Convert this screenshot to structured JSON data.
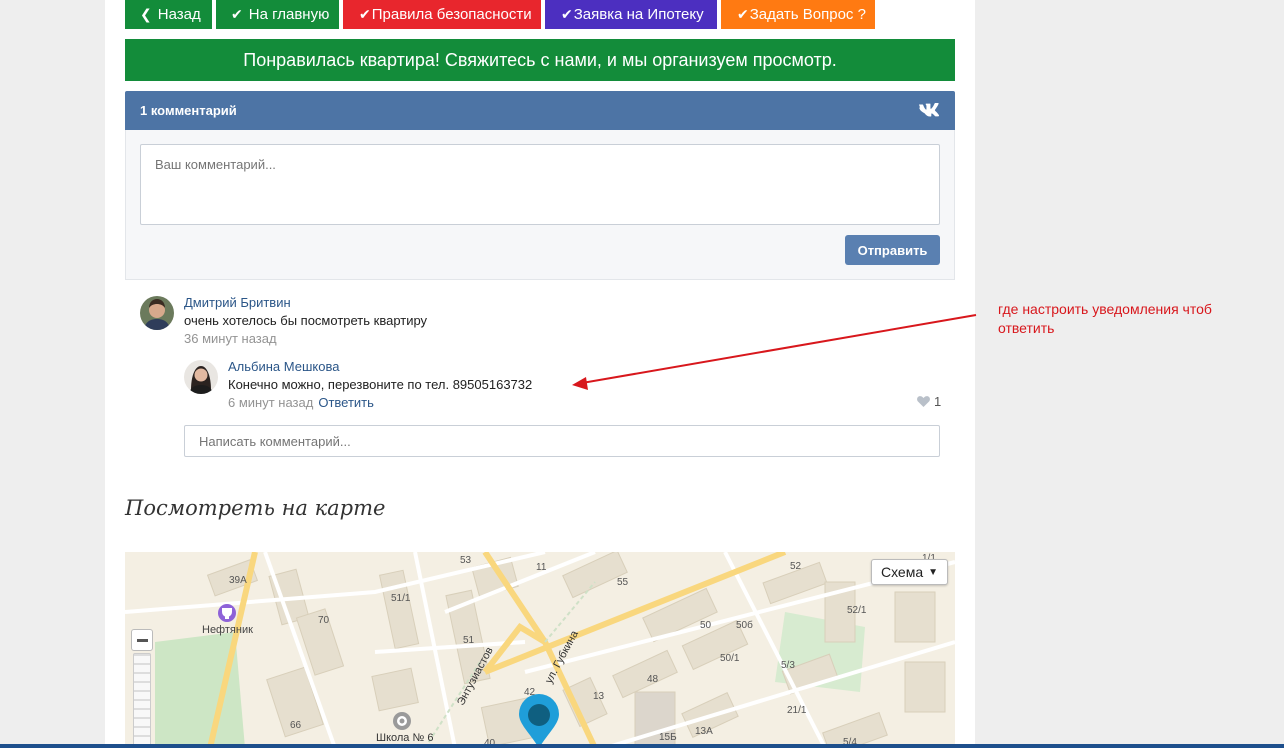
{
  "nav": {
    "back_label": "Назад",
    "home_label": "На главную",
    "rules_label": "Правила безопасности",
    "mortgage_label": "Заявка на Ипотеку",
    "ask_label": "Задать Вопрос ?"
  },
  "promo_text": "Понравилась квартира! Свяжитесь с нами, и мы организуем просмотр.",
  "comments_widget": {
    "count_label": "1 комментарий",
    "textarea_placeholder": "Ваш комментарий...",
    "send_label": "Отправить",
    "reply_placeholder": "Написать комментарий..."
  },
  "comments": [
    {
      "author": "Дмитрий Бритвин",
      "text": "очень хотелось бы посмотреть квартиру",
      "time": "36 минут назад"
    },
    {
      "author": "Альбина Мешкова",
      "text": "Конечно можно, перезвоните по тел. 89505163732",
      "time": "6 минут назад",
      "reply_label": "Ответить",
      "likes": "1"
    }
  ],
  "annotation_text": "где настроить уведомления чтоб ответить",
  "map_section": {
    "title": "Посмотреть на карте",
    "scheme_label": "Схема",
    "labels": {
      "l39a": "39А",
      "neftyanik": "Нефтяник",
      "l70": "70",
      "l66": "66",
      "l511": "51/1",
      "l53": "53",
      "l51": "51",
      "l11": "11",
      "l55": "55",
      "l42": "42",
      "l40": "40",
      "school": "Школа № 6",
      "entuz": "Энтузиастов",
      "gubkina": "ул. Губкина",
      "l13": "13",
      "l48": "48",
      "l50": "50",
      "l50b": "50б",
      "l501": "50/1",
      "l15b": "15Б",
      "l13a": "13А",
      "l53b": "5/3",
      "l211": "21/1",
      "l52": "52",
      "l521": "52/1",
      "l11b": "1/1",
      "l54": "5/4"
    },
    "colors": {
      "road_major": "#f9d77e",
      "block": "#e6dfcf",
      "park": "#cde6c5",
      "pin": "#1f9ed9"
    }
  }
}
